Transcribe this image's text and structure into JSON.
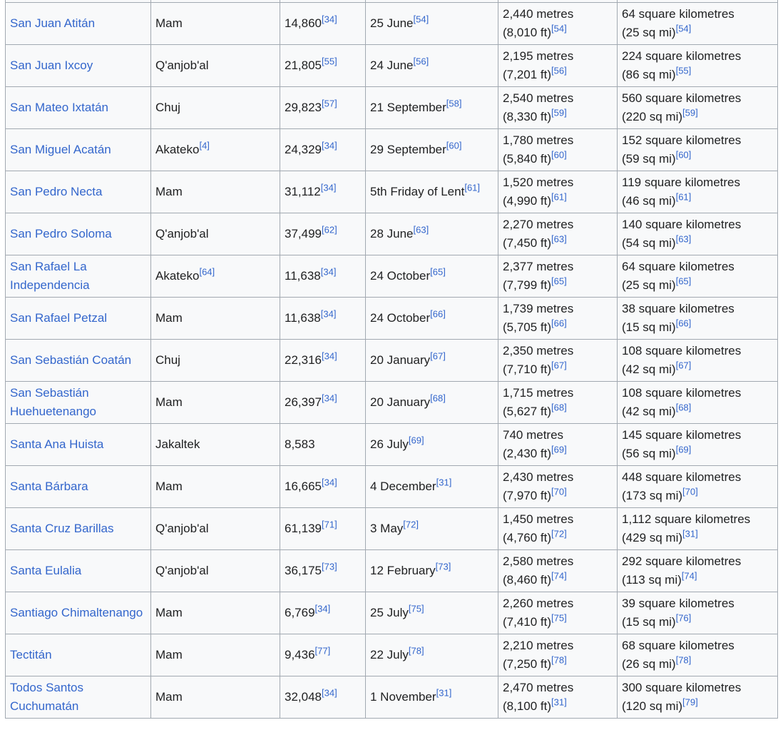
{
  "rows": [
    {
      "municipality": "San Juan Atitán",
      "language": "Mam",
      "language_ref": "",
      "population": "14,860",
      "population_ref": "34",
      "festival": "25 June",
      "festival_ref": "54",
      "altitude_m": "2,440 metres",
      "altitude_ft": "(8,010 ft)",
      "altitude_ref": "54",
      "area_km": "64 square kilometres",
      "area_mi": "(25 sq mi)",
      "area_ref": "54"
    },
    {
      "municipality": "San Juan Ixcoy",
      "language": "Q'anjob'al",
      "language_ref": "",
      "population": "21,805",
      "population_ref": "55",
      "festival": "24 June",
      "festival_ref": "56",
      "altitude_m": "2,195 metres",
      "altitude_ft": "(7,201 ft)",
      "altitude_ref": "56",
      "area_km": "224 square kilometres",
      "area_mi": "(86 sq mi)",
      "area_ref": "55"
    },
    {
      "municipality": "San Mateo Ixtatán",
      "language": "Chuj",
      "language_ref": "",
      "population": "29,823",
      "population_ref": "57",
      "festival": "21 September",
      "festival_ref": "58",
      "altitude_m": "2,540 metres",
      "altitude_ft": "(8,330 ft)",
      "altitude_ref": "59",
      "area_km": "560 square kilometres",
      "area_mi": "(220 sq mi)",
      "area_ref": "59"
    },
    {
      "municipality": "San Miguel Acatán",
      "language": "Akateko",
      "language_ref": "4",
      "population": "24,329",
      "population_ref": "34",
      "festival": "29 September",
      "festival_ref": "60",
      "altitude_m": "1,780 metres",
      "altitude_ft": "(5,840 ft)",
      "altitude_ref": "60",
      "area_km": "152 square kilometres",
      "area_mi": "(59 sq mi)",
      "area_ref": "60"
    },
    {
      "municipality": "San Pedro Necta",
      "language": "Mam",
      "language_ref": "",
      "population": "31,112",
      "population_ref": "34",
      "festival": "5th Friday of Lent",
      "festival_ref": "61",
      "altitude_m": "1,520 metres",
      "altitude_ft": "(4,990 ft)",
      "altitude_ref": "61",
      "area_km": "119 square kilometres",
      "area_mi": "(46 sq mi)",
      "area_ref": "61"
    },
    {
      "municipality": "San Pedro Soloma",
      "language": "Q'anjob'al",
      "language_ref": "",
      "population": "37,499",
      "population_ref": "62",
      "festival": "28 June",
      "festival_ref": "63",
      "altitude_m": "2,270 metres",
      "altitude_ft": "(7,450 ft)",
      "altitude_ref": "63",
      "area_km": "140 square kilometres",
      "area_mi": "(54 sq mi)",
      "area_ref": "63"
    },
    {
      "municipality": "San Rafael La Independencia",
      "language": "Akateko",
      "language_ref": "64",
      "population": "11,638",
      "population_ref": "34",
      "festival": "24 October",
      "festival_ref": "65",
      "altitude_m": "2,377 metres",
      "altitude_ft": "(7,799 ft)",
      "altitude_ref": "65",
      "area_km": "64 square kilometres",
      "area_mi": "(25 sq mi)",
      "area_ref": "65"
    },
    {
      "municipality": "San Rafael Petzal",
      "language": "Mam",
      "language_ref": "",
      "population": "11,638",
      "population_ref": "34",
      "festival": "24 October",
      "festival_ref": "66",
      "altitude_m": "1,739 metres",
      "altitude_ft": "(5,705 ft)",
      "altitude_ref": "66",
      "area_km": "38 square kilometres",
      "area_mi": "(15 sq mi)",
      "area_ref": "66"
    },
    {
      "municipality": "San Sebastián Coatán",
      "language": "Chuj",
      "language_ref": "",
      "population": "22,316",
      "population_ref": "34",
      "festival": "20 January",
      "festival_ref": "67",
      "altitude_m": "2,350 metres",
      "altitude_ft": "(7,710 ft)",
      "altitude_ref": "67",
      "area_km": "108 square kilometres",
      "area_mi": "(42 sq mi)",
      "area_ref": "67"
    },
    {
      "municipality": "San Sebastián Huehuetenango",
      "language": "Mam",
      "language_ref": "",
      "population": "26,397",
      "population_ref": "34",
      "festival": "20 January",
      "festival_ref": "68",
      "altitude_m": "1,715 metres",
      "altitude_ft": "(5,627 ft)",
      "altitude_ref": "68",
      "area_km": "108 square kilometres",
      "area_mi": "(42 sq mi)",
      "area_ref": "68"
    },
    {
      "municipality": "Santa Ana Huista",
      "language": "Jakaltek",
      "language_ref": "",
      "population": "8,583",
      "population_ref": "",
      "festival": "26 July",
      "festival_ref": "69",
      "altitude_m": "740 metres",
      "altitude_ft": "(2,430 ft)",
      "altitude_ref": "69",
      "area_km": "145 square kilometres",
      "area_mi": "(56 sq mi)",
      "area_ref": "69"
    },
    {
      "municipality": "Santa Bárbara",
      "language": "Mam",
      "language_ref": "",
      "population": "16,665",
      "population_ref": "34",
      "festival": "4 December",
      "festival_ref": "31",
      "altitude_m": "2,430 metres",
      "altitude_ft": "(7,970 ft)",
      "altitude_ref": "70",
      "area_km": "448 square kilometres",
      "area_mi": "(173 sq mi)",
      "area_ref": "70"
    },
    {
      "municipality": "Santa Cruz Barillas",
      "language": "Q'anjob'al",
      "language_ref": "",
      "population": "61,139",
      "population_ref": "71",
      "festival": "3 May",
      "festival_ref": "72",
      "altitude_m": "1,450 metres",
      "altitude_ft": "(4,760 ft)",
      "altitude_ref": "72",
      "area_km": "1,112 square kilometres",
      "area_mi": "(429 sq mi)",
      "area_ref": "31"
    },
    {
      "municipality": "Santa Eulalia",
      "language": "Q'anjob'al",
      "language_ref": "",
      "population": "36,175",
      "population_ref": "73",
      "festival": "12 February",
      "festival_ref": "73",
      "altitude_m": "2,580 metres",
      "altitude_ft": "(8,460 ft)",
      "altitude_ref": "74",
      "area_km": "292 square kilometres",
      "area_mi": "(113 sq mi)",
      "area_ref": "74"
    },
    {
      "municipality": "Santiago Chimaltenango",
      "language": "Mam",
      "language_ref": "",
      "population": "6,769",
      "population_ref": "34",
      "festival": "25 July",
      "festival_ref": "75",
      "altitude_m": "2,260 metres",
      "altitude_ft": "(7,410 ft)",
      "altitude_ref": "75",
      "area_km": "39 square kilometres",
      "area_mi": "(15 sq mi)",
      "area_ref": "76"
    },
    {
      "municipality": "Tectitán",
      "language": "Mam",
      "language_ref": "",
      "population": "9,436",
      "population_ref": "77",
      "festival": "22 July",
      "festival_ref": "78",
      "altitude_m": "2,210 metres",
      "altitude_ft": "(7,250 ft)",
      "altitude_ref": "78",
      "area_km": "68 square kilometres",
      "area_mi": "(26 sq mi)",
      "area_ref": "78"
    },
    {
      "municipality": "Todos Santos Cuchumatán",
      "language": "Mam",
      "language_ref": "",
      "population": "32,048",
      "population_ref": "34",
      "festival": "1 November",
      "festival_ref": "31",
      "altitude_m": "2,470 metres",
      "altitude_ft": "(8,100 ft)",
      "altitude_ref": "31",
      "area_km": "300 square kilometres",
      "area_mi": "(120 sq mi)",
      "area_ref": "79"
    }
  ]
}
